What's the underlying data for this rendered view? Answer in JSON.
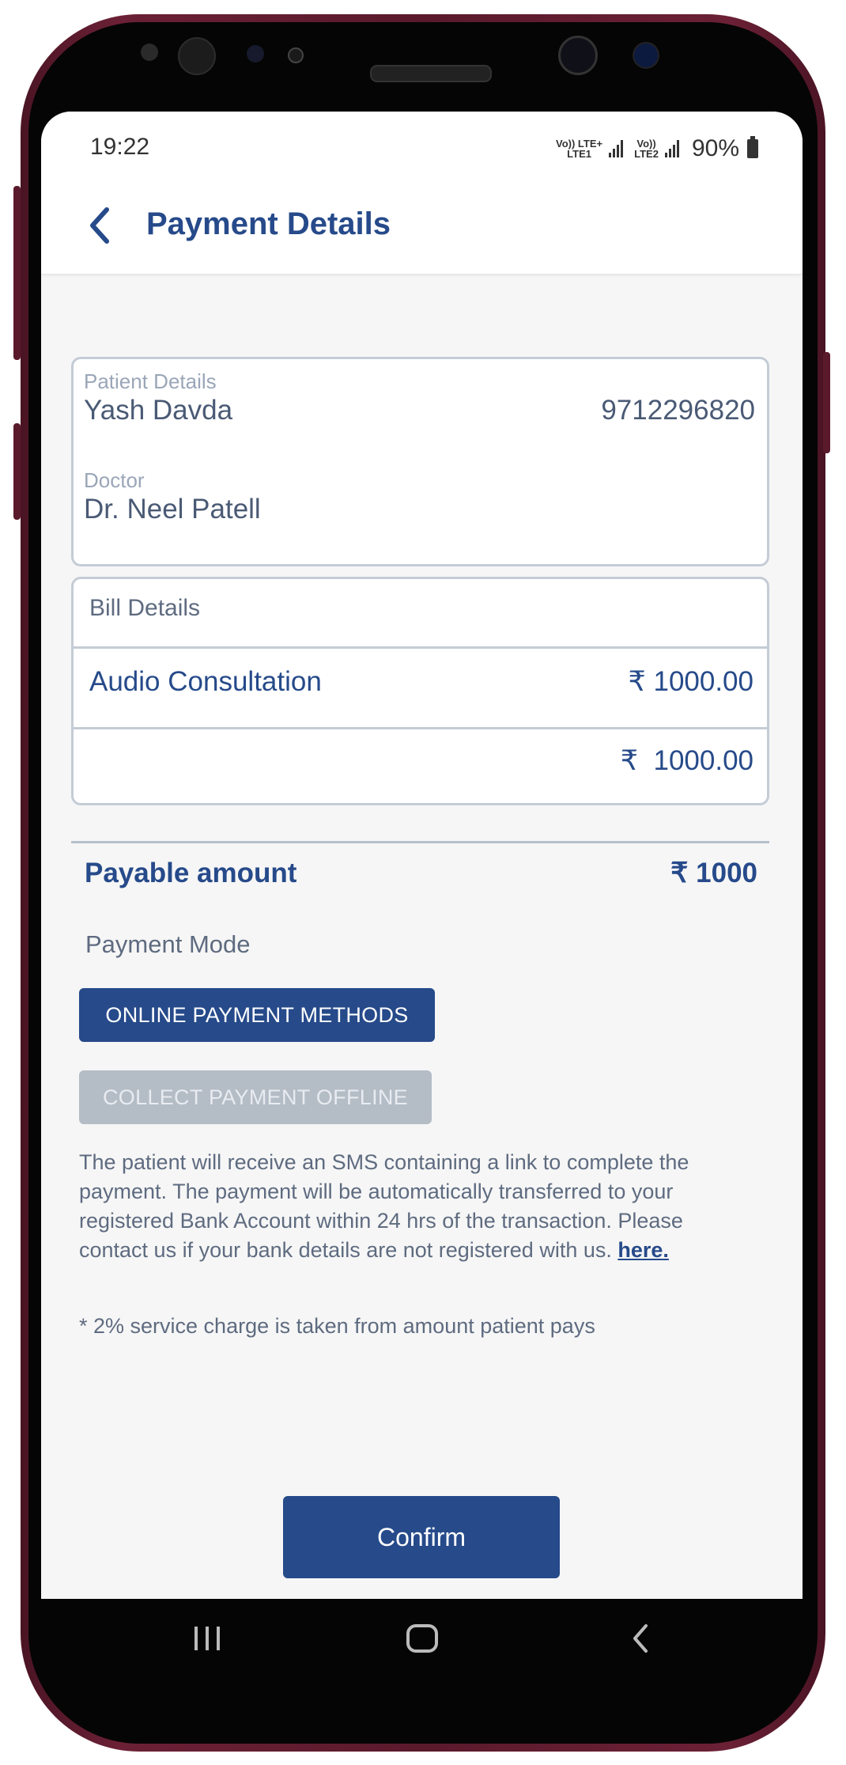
{
  "status_bar": {
    "time": "19:22",
    "sim1_tag_top": "Vo)) LTE+",
    "sim1_tag_bottom": "LTE1",
    "sim2_tag_top": "Vo))",
    "sim2_tag_bottom": "LTE2",
    "battery": "90%"
  },
  "header": {
    "title": "Payment Details",
    "back_icon": "chevron-left-icon"
  },
  "patient": {
    "section_label": "Patient Details",
    "name": "Yash Davda",
    "phone": "9712296820",
    "doctor_label": "Doctor",
    "doctor_name": "Dr. Neel Patell"
  },
  "bill": {
    "section_label": "Bill Details",
    "items": [
      {
        "name": "Audio Consultation",
        "amount": "₹ 1000.00"
      }
    ],
    "total": "₹  1000.00"
  },
  "payable": {
    "label": "Payable amount",
    "value": "₹ 1000"
  },
  "payment_mode": {
    "label": "Payment Mode",
    "online_button": "ONLINE PAYMENT METHODS",
    "offline_button": "COLLECT PAYMENT OFFLINE"
  },
  "info": {
    "text": "The patient will receive an SMS containing a link to complete the payment. The payment will be automatically transferred to your registered Bank Account within 24 hrs of the transaction. Please contact us if your bank details are not registered with us. ",
    "link": "here.",
    "note": "* 2% service charge is taken from amount patient pays"
  },
  "confirm_button": "Confirm",
  "colors": {
    "primary": "#264a8a",
    "disabled_button": "#b4bcc6",
    "card_border": "#c4ccd6",
    "background": "#f6f6f6"
  }
}
